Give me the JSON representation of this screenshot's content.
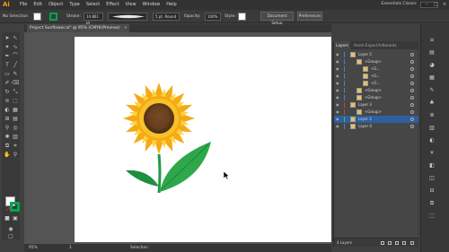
{
  "menubar": {
    "logo": "Ai",
    "items": [
      "File",
      "Edit",
      "Object",
      "Type",
      "Select",
      "Effect",
      "View",
      "Window",
      "Help"
    ],
    "workspace": "Essentials Classic",
    "window_buttons": [
      "–",
      "□",
      "×"
    ]
  },
  "controlbar": {
    "selection_label": "No Selection",
    "stroke_label": "Stroke:",
    "stroke_value": "14.861 pt",
    "brush_value": "5 pt. Round",
    "opacity_label": "Opacity:",
    "opacity_value": "100%",
    "style_label": "Style:",
    "doc_setup": "Document Setup",
    "prefs": "Preferences",
    "fill_color": "#ffffff",
    "stroke_color": "#00a651"
  },
  "document": {
    "tab_title": "Project Sunflower.ai* @ 95% (CMYK/Preview)",
    "tab_close": "×"
  },
  "status": {
    "zoom": "95%",
    "artboard_num": "1",
    "mode": "Selection"
  },
  "layers_panel": {
    "tabs": [
      "Layers",
      "Asset Export",
      "Artboards"
    ],
    "rows": [
      {
        "name": "Layer 5",
        "indent": 0,
        "color": "#4f7bd9",
        "selected": false
      },
      {
        "name": "<Group>",
        "indent": 1,
        "color": "#4f7bd9",
        "selected": false
      },
      {
        "name": "<G...",
        "indent": 2,
        "color": "#4f7bd9",
        "selected": false
      },
      {
        "name": "<G...",
        "indent": 2,
        "color": "#4f7bd9",
        "selected": false
      },
      {
        "name": "<G...",
        "indent": 2,
        "color": "#4f7bd9",
        "selected": false
      },
      {
        "name": "<Group>",
        "indent": 1,
        "color": "#4f7bd9",
        "selected": false
      },
      {
        "name": "<Group>",
        "indent": 1,
        "color": "#4f7bd9",
        "selected": false
      },
      {
        "name": "Layer 3",
        "indent": 0,
        "color": "#d43c3c",
        "selected": false
      },
      {
        "name": "<Group>",
        "indent": 1,
        "color": "#d43c3c",
        "selected": false
      },
      {
        "name": "Layer 2",
        "indent": 0,
        "color": "#3cc44a",
        "selected": true
      },
      {
        "name": "Layer 4",
        "indent": 0,
        "color": "#4f7bd9",
        "selected": false
      }
    ],
    "footer_count": "4 Layers"
  },
  "colors": {
    "petal": "#f7b719",
    "petal_inner": "#fcd33c",
    "center_dark": "#5a3418",
    "center_mid": "#7a4a26",
    "stem": "#1f9a4a",
    "leaf": "#3bb34a"
  }
}
